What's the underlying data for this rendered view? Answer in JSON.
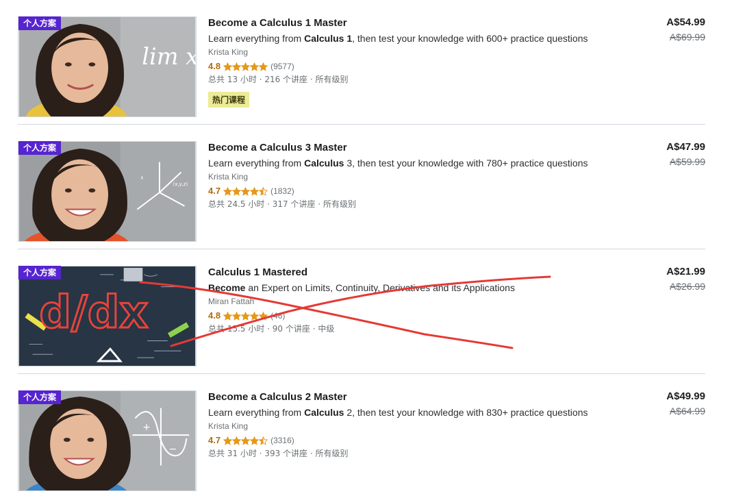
{
  "courses": [
    {
      "badge": "个人方案",
      "title": "Become a Calculus 1 Master",
      "subtitle_pre": "Learn everything from ",
      "subtitle_bold": "Calculus 1",
      "subtitle_post": ", then test your knowledge with 600+ practice questions",
      "instructor": "Krista King",
      "rating": "4.8",
      "rating_value": 4.8,
      "reviews": "(9577)",
      "meta": "总共 13 小时 · 216 个讲座 · 所有级别",
      "tag": "热门课程",
      "price": "A$54.99",
      "original_price": "A$69.99",
      "thumb_text": "lim x→a"
    },
    {
      "badge": "个人方案",
      "title": "Become a Calculus 3 Master",
      "subtitle_pre": "Learn everything from ",
      "subtitle_bold": "Calculus",
      "subtitle_post": " 3, then test your knowledge with 780+ practice questions",
      "instructor": "Krista King",
      "rating": "4.7",
      "rating_value": 4.7,
      "reviews": "(1832)",
      "meta": "总共 24.5 小时 · 317 个讲座 · 所有级别",
      "tag": "",
      "price": "A$47.99",
      "original_price": "A$59.99"
    },
    {
      "badge": "个人方案",
      "title": "Calculus 1 Mastered",
      "subtitle_pre": "",
      "subtitle_bold": "Become",
      "subtitle_post": " an Expert on Limits, Continuity, Derivatives and its Applications",
      "instructor": "Miran Fattah",
      "rating": "4.8",
      "rating_value": 4.8,
      "reviews": "(46)",
      "meta": "总共 15.5 小时 · 90 个讲座 · 中级",
      "tag": "",
      "price": "A$21.99",
      "original_price": "A$26.99",
      "thumb_text": "d/dx"
    },
    {
      "badge": "个人方案",
      "title": "Become a Calculus 2 Master",
      "subtitle_pre": "Learn everything from ",
      "subtitle_bold": "Calculus",
      "subtitle_post": " 2, then test your knowledge with 830+ practice questions",
      "instructor": "Krista King",
      "rating": "4.7",
      "rating_value": 4.7,
      "reviews": "(3316)",
      "meta": "总共 31 小时 · 393 个讲座 · 所有级别",
      "tag": "",
      "price": "A$49.99",
      "original_price": "A$64.99"
    }
  ],
  "colors": {
    "badge": "#5624d0",
    "rating": "#b4690e",
    "star": "#e59819",
    "tag_bg": "#eceb98",
    "scribble": "#e53935"
  },
  "icons": [
    "star-icon",
    "half-star-icon"
  ]
}
